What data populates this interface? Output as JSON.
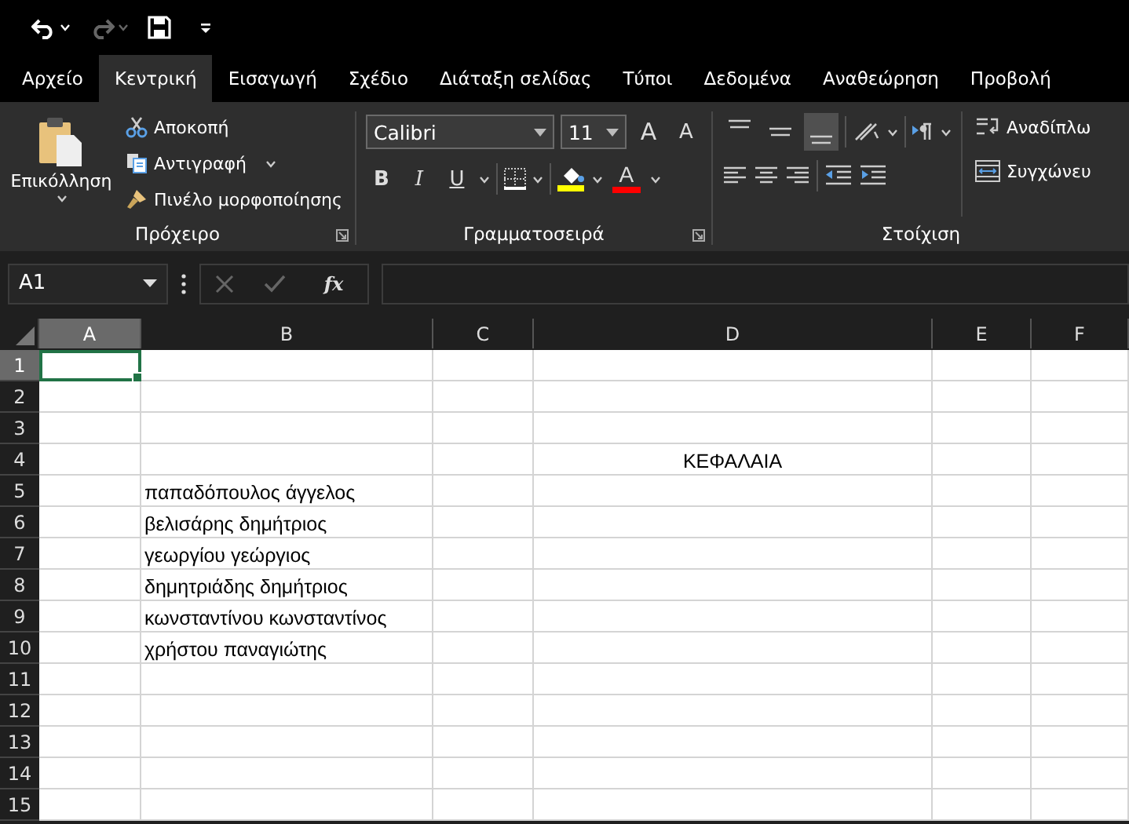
{
  "quick_access": {
    "undo": {
      "disabled": false
    },
    "redo": {
      "disabled": true
    }
  },
  "tabs": [
    {
      "label": "Αρχείο",
      "selected": false
    },
    {
      "label": "Κεντρική",
      "selected": true
    },
    {
      "label": "Εισαγωγή",
      "selected": false
    },
    {
      "label": "Σχέδιο",
      "selected": false
    },
    {
      "label": "Διάταξη σελίδας",
      "selected": false
    },
    {
      "label": "Τύποι",
      "selected": false
    },
    {
      "label": "Δεδομένα",
      "selected": false
    },
    {
      "label": "Αναθεώρηση",
      "selected": false
    },
    {
      "label": "Προβολή",
      "selected": false
    }
  ],
  "clipboard": {
    "paste": "Επικόλληση",
    "cut": "Αποκοπή",
    "copy": "Αντιγραφή",
    "format_painter": "Πινέλο μορφοποίησης",
    "label": "Πρόχειρο"
  },
  "font": {
    "name": "Calibri",
    "size": "11",
    "grow": "A",
    "shrink": "A",
    "bold": "B",
    "italic": "I",
    "underline": "U",
    "font_color": "A",
    "label": "Γραμματοσειρά"
  },
  "alignment": {
    "vertical": [
      {
        "kind": "top",
        "selected": false
      },
      {
        "kind": "middle",
        "selected": false
      },
      {
        "kind": "bottom",
        "selected": true
      }
    ],
    "wrap_text": "Αναδίπλω",
    "merge": "Συγχώνευ",
    "label": "Στοίχιση"
  },
  "formula_bar": {
    "name_box": "A1",
    "function": "fx"
  },
  "columns": [
    {
      "label": "A",
      "selected": true
    },
    {
      "label": "B",
      "selected": false
    },
    {
      "label": "C",
      "selected": false
    },
    {
      "label": "D",
      "selected": false
    },
    {
      "label": "E",
      "selected": false
    },
    {
      "label": "F",
      "selected": false
    }
  ],
  "rows": [
    {
      "label": "1",
      "selected": true,
      "cells": {}
    },
    {
      "label": "2",
      "selected": false,
      "cells": {}
    },
    {
      "label": "3",
      "selected": false,
      "cells": {}
    },
    {
      "label": "4",
      "selected": false,
      "cells": {
        "D": {
          "text": "ΚΕΦΑΛΑΙΑ",
          "kind": "centered"
        }
      }
    },
    {
      "label": "5",
      "selected": false,
      "cells": {
        "B": {
          "text": "παπαδόπουλος άγγελος",
          "kind": "plain"
        }
      }
    },
    {
      "label": "6",
      "selected": false,
      "cells": {
        "B": {
          "text": "βελισάρης δημήτριος",
          "kind": "plain"
        }
      }
    },
    {
      "label": "7",
      "selected": false,
      "cells": {
        "B": {
          "text": "γεωργίου γεώργιος",
          "kind": "plain"
        }
      }
    },
    {
      "label": "8",
      "selected": false,
      "cells": {
        "B": {
          "text": "δημητριάδης δημήτριος",
          "kind": "plain"
        }
      }
    },
    {
      "label": "9",
      "selected": false,
      "cells": {
        "B": {
          "text": "κωνσταντίνου κωνσταντίνος",
          "kind": "plain"
        }
      }
    },
    {
      "label": "10",
      "selected": false,
      "cells": {
        "B": {
          "text": "χρήστου παναγιώτης",
          "kind": "plain"
        }
      }
    },
    {
      "label": "11",
      "selected": false,
      "cells": {}
    },
    {
      "label": "12",
      "selected": false,
      "cells": {}
    },
    {
      "label": "13",
      "selected": false,
      "cells": {}
    },
    {
      "label": "14",
      "selected": false,
      "cells": {}
    },
    {
      "label": "15",
      "selected": false,
      "cells": {}
    }
  ]
}
